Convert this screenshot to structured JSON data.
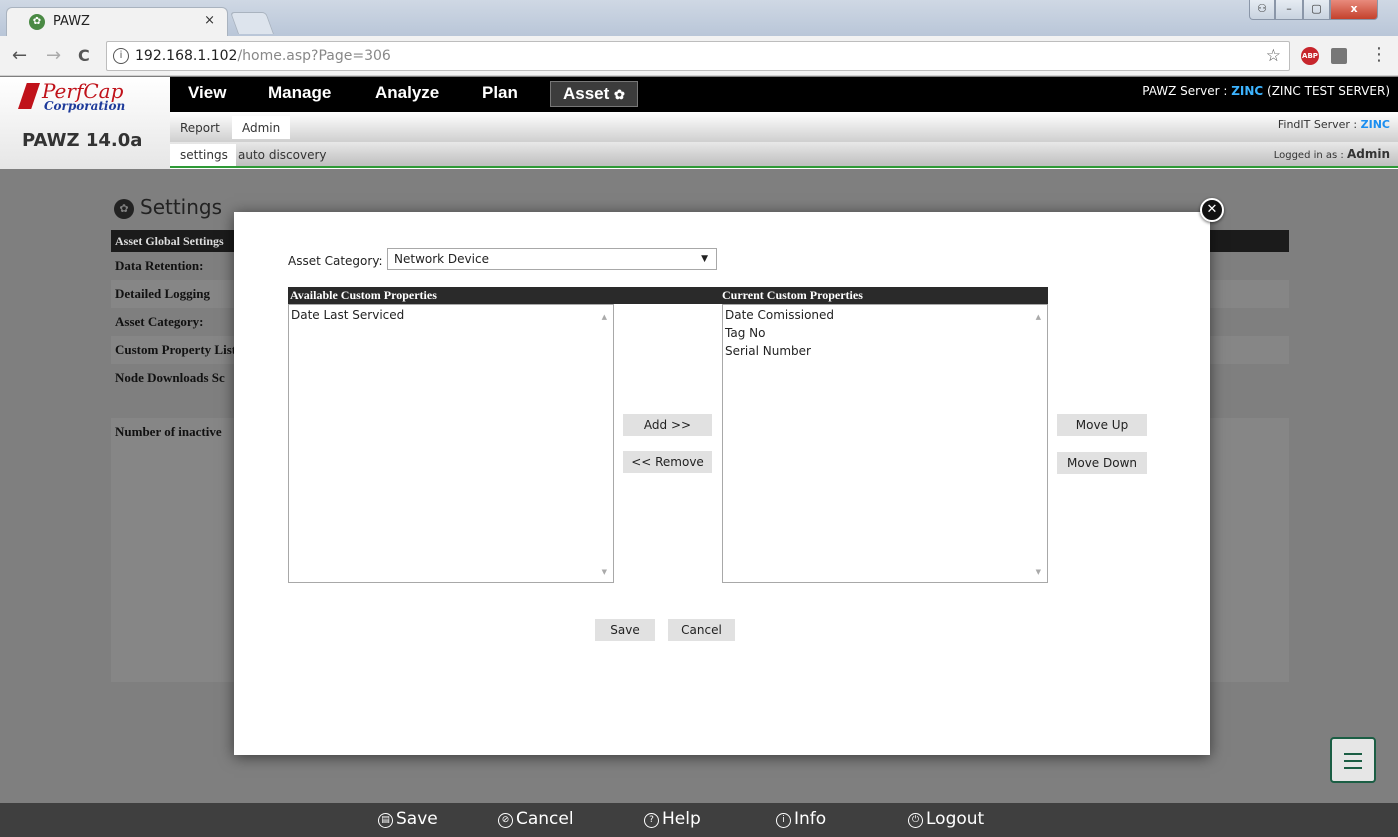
{
  "browser": {
    "tab_title": "PAWZ",
    "tab_close": "×",
    "url_host": "192.168.1.102",
    "url_path": "/home.asp?Page=306",
    "star": "☆",
    "abp": "ABP",
    "back": "←",
    "forward": "→",
    "reload": "C",
    "menu": "⋮",
    "info": "i",
    "win_min": "–",
    "win_max": "▢",
    "win_close": "x",
    "win_user": "⚇"
  },
  "header": {
    "logo_name": "PerfCap",
    "logo_sub": "Corporation",
    "version": "PAWZ 14.0a",
    "menu": [
      "View",
      "Manage",
      "Analyze",
      "Plan",
      "Asset"
    ],
    "active_menu_icon": "paw-icon",
    "paw": "✿",
    "server_label": "PAWZ Server : ",
    "server_name": "ZINC",
    "server_desc": " (ZINC TEST SERVER)",
    "subtabs": [
      "Report",
      "Admin"
    ],
    "findit_label": "FindIT Server : ",
    "findit_name": "ZINC",
    "subtabs2": [
      "settings",
      "auto discovery"
    ],
    "logged_label": "Logged in as : ",
    "logged_user": "Admin"
  },
  "background_page": {
    "title": "Settings",
    "rows": [
      "Asset Global Settings",
      "Data Retention:",
      "Detailed Logging",
      "Asset Category:",
      "Custom Property List",
      "Node Downloads Sc",
      "Number of inactive"
    ]
  },
  "modal": {
    "close": "✕",
    "category_label": "Asset Category:",
    "category_value": "Network Device",
    "select_arrow": "▼",
    "available_header": "Available Custom Properties",
    "current_header": "Current Custom Properties",
    "available_items": [
      "Date Last Serviced"
    ],
    "current_items": [
      "Date Comissioned",
      "Tag No",
      "Serial Number"
    ],
    "scroll_up": "▲",
    "scroll_down": "▼",
    "add_label": "Add  >>",
    "remove_label": "<< Remove",
    "move_up_label": "Move Up",
    "move_down_label": "Move Down",
    "save_label": "Save",
    "cancel_label": "Cancel"
  },
  "footer": {
    "items": [
      {
        "label": "Save",
        "icon": "save-icon",
        "glyph": "▤"
      },
      {
        "label": "Cancel",
        "icon": "cancel-icon",
        "glyph": "⊘"
      },
      {
        "label": "Help",
        "icon": "help-icon",
        "glyph": "?"
      },
      {
        "label": "Info",
        "icon": "info-icon",
        "glyph": "i"
      },
      {
        "label": "Logout",
        "icon": "power-icon",
        "glyph": "⏻"
      }
    ]
  },
  "colors": {
    "accent_blue": "#3db4ff",
    "brand_red": "#c0121a",
    "green_rule": "#2e9a36"
  }
}
